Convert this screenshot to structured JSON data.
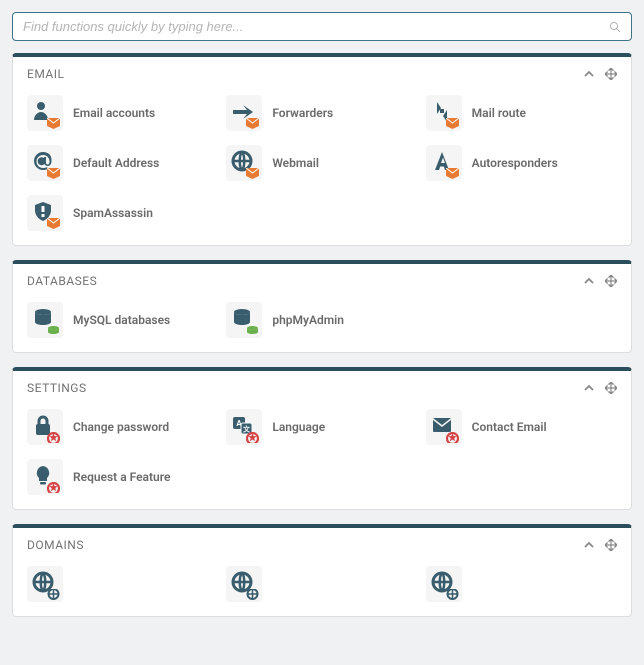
{
  "search": {
    "placeholder": "Find functions quickly by typing here..."
  },
  "panels": [
    {
      "title": "EMAIL",
      "accent": "orange",
      "items": [
        {
          "id": "email-accounts",
          "label": "Email accounts",
          "glyph": "user"
        },
        {
          "id": "forwarders",
          "label": "Forwarders",
          "glyph": "arrow"
        },
        {
          "id": "mail-route",
          "label": "Mail route",
          "glyph": "route"
        },
        {
          "id": "default-address",
          "label": "Default Address",
          "glyph": "at"
        },
        {
          "id": "webmail",
          "label": "Webmail",
          "glyph": "globe"
        },
        {
          "id": "autoresponders",
          "label": "Autoresponders",
          "glyph": "letter-a"
        },
        {
          "id": "spamassassin",
          "label": "SpamAssassin",
          "glyph": "shield"
        }
      ]
    },
    {
      "title": "DATABASES",
      "accent": "green",
      "items": [
        {
          "id": "mysql-databases",
          "label": "MySQL databases",
          "glyph": "db"
        },
        {
          "id": "phpmyadmin",
          "label": "phpMyAdmin",
          "glyph": "db"
        }
      ]
    },
    {
      "title": "SETTINGS",
      "accent": "red",
      "items": [
        {
          "id": "change-password",
          "label": "Change password",
          "glyph": "lock"
        },
        {
          "id": "language",
          "label": "Language",
          "glyph": "lang"
        },
        {
          "id": "contact-email",
          "label": "Contact Email",
          "glyph": "mail"
        },
        {
          "id": "request-feature",
          "label": "Request a Feature",
          "glyph": "bulb"
        }
      ]
    },
    {
      "title": "DOMAINS",
      "accent": "blue",
      "items": [
        {
          "id": "domain1",
          "label": "",
          "glyph": "globe"
        },
        {
          "id": "domain2",
          "label": "",
          "glyph": "globe"
        },
        {
          "id": "domain3",
          "label": "",
          "glyph": "globe"
        }
      ]
    }
  ]
}
